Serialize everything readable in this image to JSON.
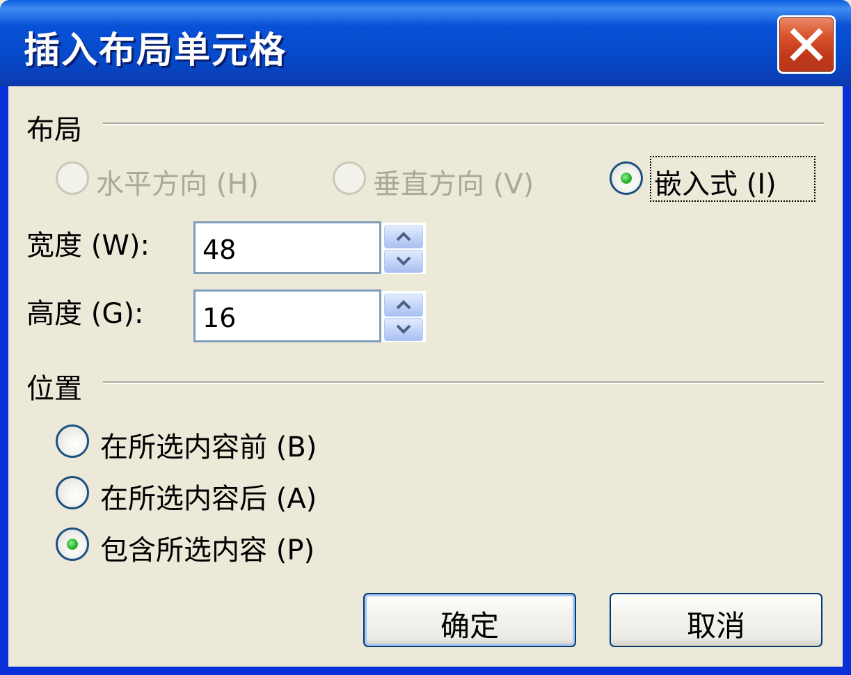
{
  "window": {
    "title": "插入布局单元格"
  },
  "layout_section": {
    "heading": "布局",
    "options": [
      {
        "label": "水平方向 (H)",
        "selected": false,
        "enabled": false
      },
      {
        "label": "垂直方向 (V)",
        "selected": false,
        "enabled": false
      },
      {
        "label": "嵌入式 (I)",
        "selected": true,
        "enabled": true
      }
    ]
  },
  "fields": {
    "width": {
      "label": "宽度 (W):",
      "value": "48"
    },
    "height": {
      "label": "高度 (G):",
      "value": "16"
    }
  },
  "position_section": {
    "heading": "位置",
    "options": [
      {
        "label": "在所选内容前 (B)",
        "selected": false
      },
      {
        "label": "在所选内容后 (A)",
        "selected": false
      },
      {
        "label": "包含所选内容 (P)",
        "selected": true
      }
    ]
  },
  "buttons": {
    "ok": "确定",
    "cancel": "取消"
  },
  "colors": {
    "titlebar": "#0551d6",
    "close_button": "#c1391a",
    "dialog_background": "#ece9d8",
    "radio_dot": "#2ab42a"
  }
}
